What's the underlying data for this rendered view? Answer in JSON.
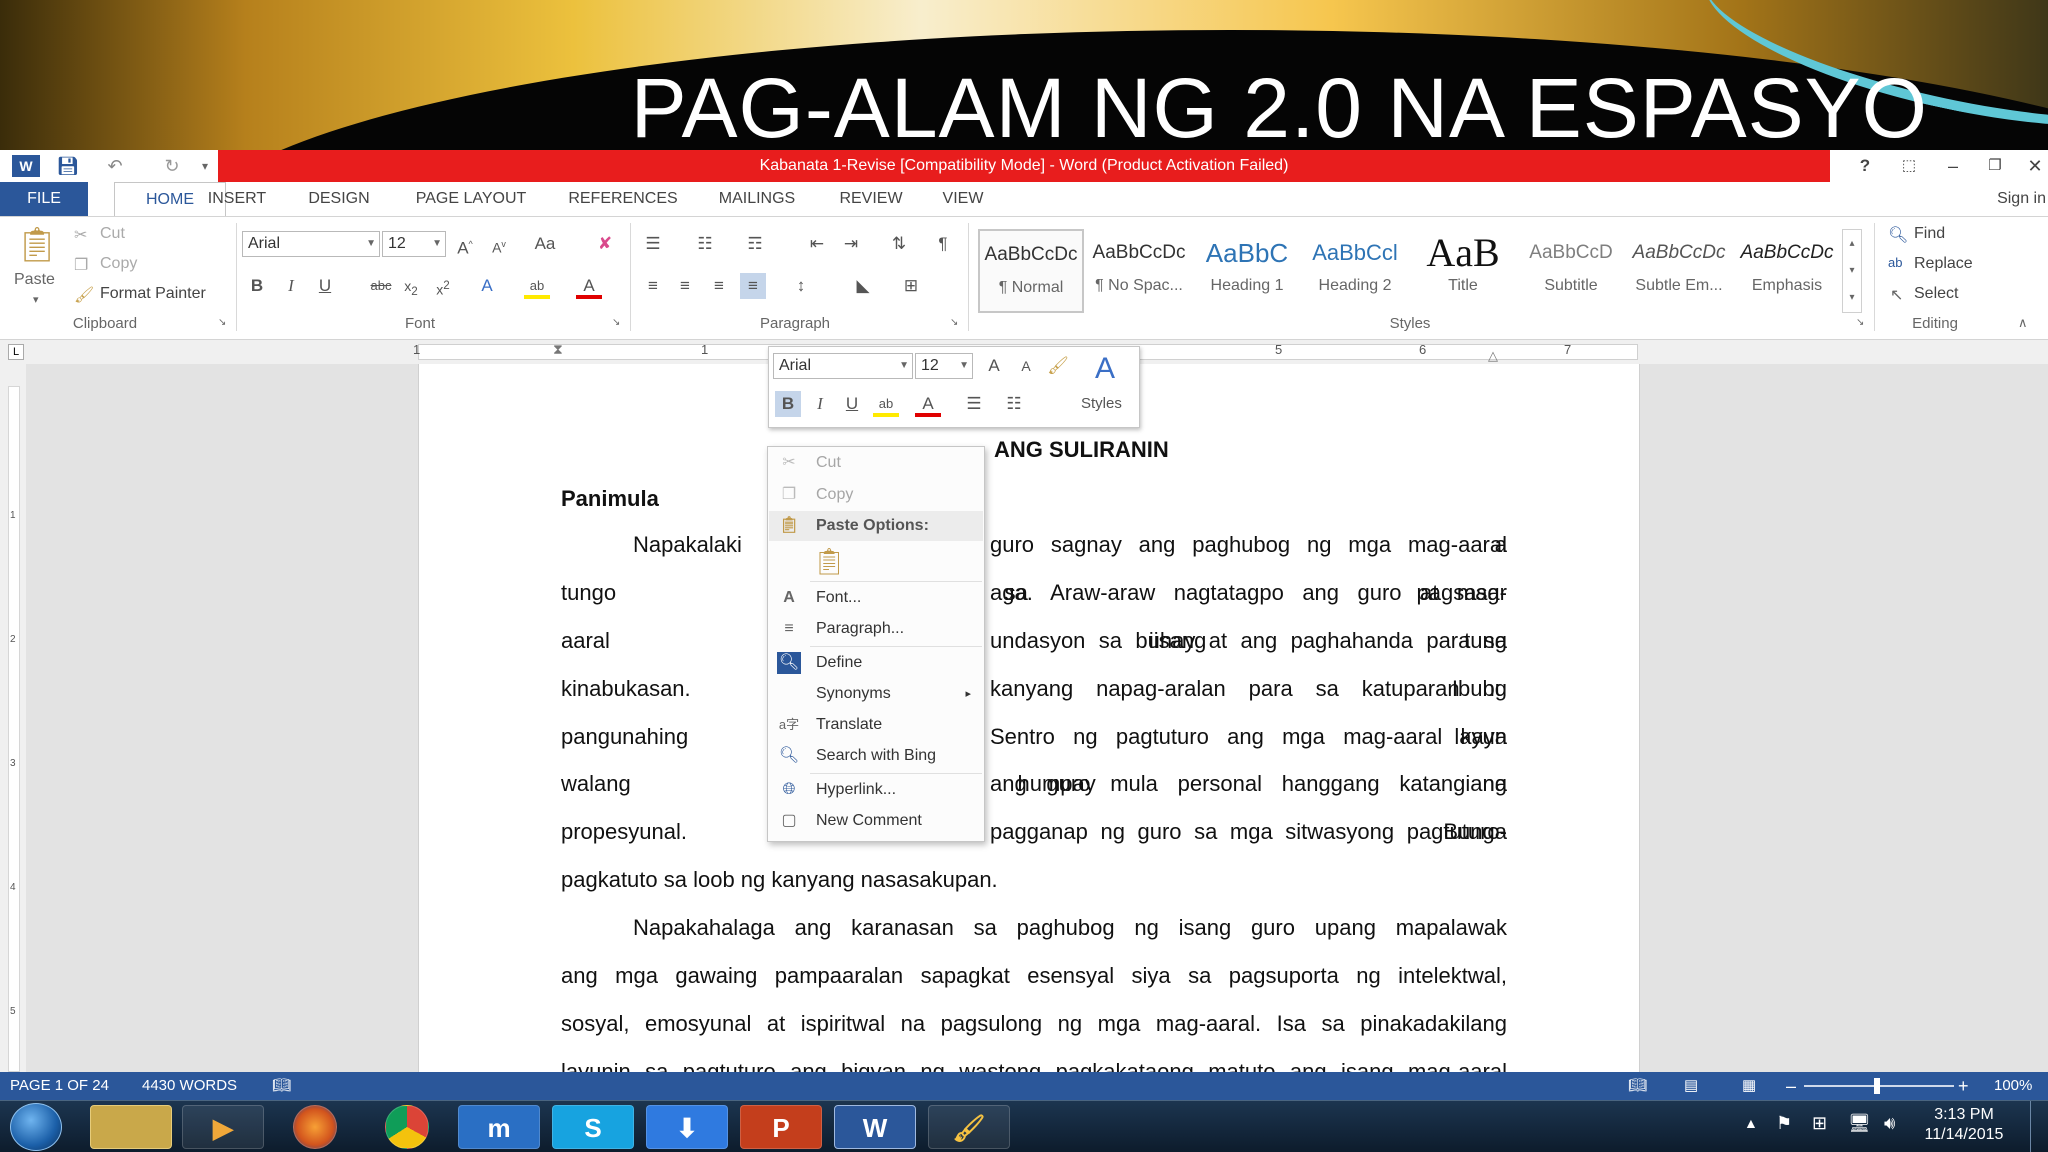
{
  "slide": {
    "title": "PAG-ALAM NG 2.0 NA ESPASYO"
  },
  "titlebar": {
    "text": "Kabanata 1-Revise [Compatibility Mode] - Word (Product Activation Failed)"
  },
  "window_controls": {
    "help": "?",
    "minimize": "–"
  },
  "tabs": [
    {
      "label": "FILE"
    },
    {
      "label": "HOME"
    },
    {
      "label": "INSERT"
    },
    {
      "label": "DESIGN"
    },
    {
      "label": "PAGE LAYOUT"
    },
    {
      "label": "REFERENCES"
    },
    {
      "label": "MAILINGS"
    },
    {
      "label": "REVIEW"
    },
    {
      "label": "VIEW"
    }
  ],
  "signin": "Sign in",
  "clipboard": {
    "paste": "Paste",
    "cut": "Cut",
    "copy": "Copy",
    "format_painter": "Format Painter",
    "group": "Clipboard"
  },
  "font": {
    "name": "Arial",
    "size": "12",
    "group": "Font",
    "case": "Aa"
  },
  "paragraph": {
    "group": "Paragraph"
  },
  "styles": {
    "group": "Styles",
    "items": [
      {
        "sample": "AaBbCcDc",
        "name": "¶ Normal"
      },
      {
        "sample": "AaBbCcDc",
        "name": "¶ No Spac..."
      },
      {
        "sample": "AaBbC",
        "name": "Heading 1"
      },
      {
        "sample": "AaBbCcl",
        "name": "Heading 2"
      },
      {
        "sample": "AaB",
        "name": "Title"
      },
      {
        "sample": "AaBbCcD",
        "name": "Subtitle"
      },
      {
        "sample": "AaBbCcDc",
        "name": "Subtle Em..."
      },
      {
        "sample": "AaBbCcDc",
        "name": "Emphasis"
      }
    ]
  },
  "editing": {
    "find": "Find",
    "replace": "Replace",
    "select": "Select",
    "group": "Editing"
  },
  "ruler": {
    "numbers": [
      "1",
      "1",
      "5",
      "6",
      "7"
    ]
  },
  "vruler": {
    "numbers": [
      "1",
      "2",
      "3",
      "4",
      "5"
    ]
  },
  "minitoolbar": {
    "font": "Arial",
    "size": "12",
    "styles": "Styles"
  },
  "context_menu": {
    "items": [
      {
        "label": "Cut"
      },
      {
        "label": "Copy"
      },
      {
        "label": "Paste Options:"
      },
      {
        "label": "Font..."
      },
      {
        "label": "Paragraph..."
      },
      {
        "label": "Define"
      },
      {
        "label": "Synonyms"
      },
      {
        "label": "Translate"
      },
      {
        "label": "Search with Bing"
      },
      {
        "label": "Hyperlink..."
      },
      {
        "label": "New Comment"
      }
    ]
  },
  "document": {
    "heading": "ANG SULIRANIN",
    "section": "Panimula",
    "lines": [
      {
        "left": "Napakalaki a",
        "right": "guro sagnay ang paghubog ng mga mag-aaral"
      },
      {
        "left": "tungo sa pagsasar",
        "right": "aga. Araw-araw nagtatagpo ang guro at mag-"
      },
      {
        "left": "aaral sa iisang tung",
        "right": "undasyon sa buhay at ang paghahanda para sa"
      },
      {
        "left": "kinabukasan. Ibubu",
        "right": "kanyang napag-aralan para sa katuparan ng"
      },
      {
        "left": "pangunahing layun",
        "right": "Sentro ng pagtuturo ang mga mag-aaral kaya"
      },
      {
        "left": "walang humpay na",
        "right": "ang guro mula personal hanggang katangiang"
      },
      {
        "left": "propesyunal. Bunga",
        "right": "pagganap ng guro sa mga sitwasyong pagtuturo-"
      }
    ],
    "full_lines": [
      "pagkatuto sa loob ng kanyang nasasakupan.",
      "Napakahalaga ang karanasan sa paghubog ng isang guro upang mapalawak",
      "ang mga gawaing pampaaralan sapagkat esensyal siya sa pagsuporta ng intelektwal,",
      "sosyal, emosyunal at ispiritwal na pagsulong ng mga mag-aaral. Isa sa pinakadakilang",
      "layunin sa pagtuturo ang bigyan ng wastong pagkakataong matuto ang isang mag-aaral"
    ]
  },
  "status": {
    "page": "PAGE 1 OF 24",
    "words": "4430 WORDS",
    "zoom": "100%"
  },
  "clock": {
    "time": "3:13 PM",
    "date": "11/14/2015"
  },
  "taskbar": {
    "apps": [
      "file-explorer",
      "media-player",
      "firefox",
      "chrome",
      "maxthon",
      "skype",
      "downloader",
      "powerpoint",
      "word",
      "paint"
    ]
  },
  "colors": {
    "word_blue": "#2b579a",
    "titlebar_red": "#e81d1d",
    "squiggle": "#2b56d8"
  }
}
